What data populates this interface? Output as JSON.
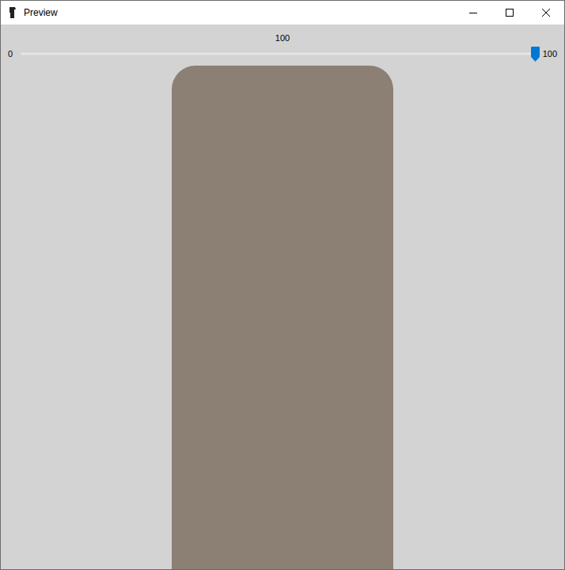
{
  "window": {
    "title": "Preview"
  },
  "slider": {
    "value": "100",
    "min": "0",
    "max": "100",
    "level": 1.0
  },
  "viewport": {
    "kind": "3d-render"
  }
}
